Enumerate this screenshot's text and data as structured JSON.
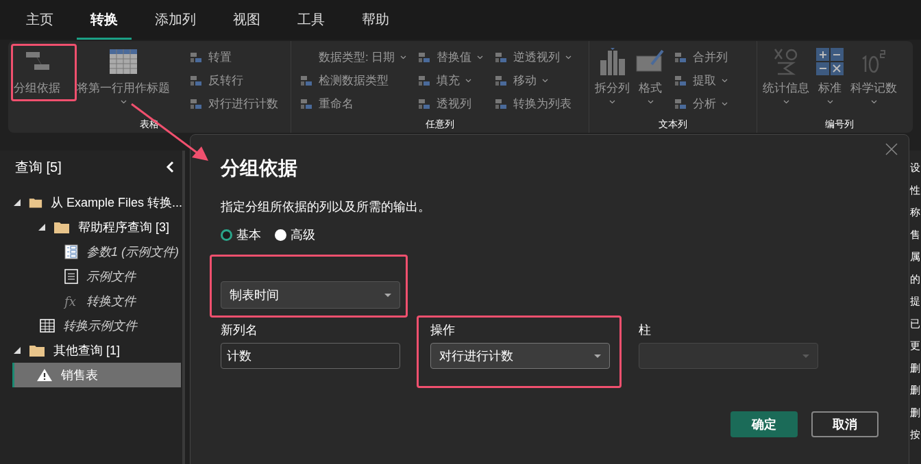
{
  "menu_tabs": [
    {
      "label": "主页",
      "selected": false
    },
    {
      "label": "转换",
      "selected": true
    },
    {
      "label": "添加列",
      "selected": false
    },
    {
      "label": "视图",
      "selected": false
    },
    {
      "label": "工具",
      "selected": false
    },
    {
      "label": "帮助",
      "selected": false
    }
  ],
  "ribbon": {
    "groups": [
      {
        "label": "表格",
        "items": [
          {
            "kind": "large",
            "label": "分组依据",
            "dropdown": false
          },
          {
            "kind": "large",
            "label": "将第一行用作标题",
            "dropdown": true
          },
          {
            "kind": "small",
            "label": "转置",
            "dropdown": false
          },
          {
            "kind": "small",
            "label": "反转行",
            "dropdown": false
          },
          {
            "kind": "small",
            "label": "对行进行计数",
            "dropdown": false
          }
        ]
      },
      {
        "label": "任意列",
        "items": [
          {
            "kind": "small",
            "label": "数据类型: 日期",
            "dropdown": true
          },
          {
            "kind": "small",
            "label": "检测数据类型",
            "dropdown": false
          },
          {
            "kind": "small",
            "label": "重命名",
            "dropdown": false
          },
          {
            "kind": "small",
            "label": "替换值",
            "dropdown": true
          },
          {
            "kind": "small",
            "label": "填充",
            "dropdown": true
          },
          {
            "kind": "small",
            "label": "透视列",
            "dropdown": false
          },
          {
            "kind": "small",
            "label": "逆透视列",
            "dropdown": true
          },
          {
            "kind": "small",
            "label": "移动",
            "dropdown": true
          },
          {
            "kind": "small",
            "label": "转换为列表",
            "dropdown": false
          }
        ]
      },
      {
        "label": "文本列",
        "items": [
          {
            "kind": "large",
            "label": "拆分列",
            "dropdown": true
          },
          {
            "kind": "large",
            "label": "格式",
            "dropdown": true
          },
          {
            "kind": "small",
            "label": "合并列",
            "dropdown": false
          },
          {
            "kind": "small",
            "label": "提取",
            "dropdown": true
          },
          {
            "kind": "small",
            "label": "分析",
            "dropdown": true
          }
        ]
      },
      {
        "label": "编号列",
        "items": [
          {
            "kind": "large",
            "label": "统计信息",
            "dropdown": true
          },
          {
            "kind": "large",
            "label": "标准",
            "dropdown": true
          },
          {
            "kind": "large",
            "label": "科学记数",
            "dropdown": true
          }
        ]
      }
    ]
  },
  "queries": {
    "title": "查询 [5]",
    "tree": [
      {
        "label": "从 Example Files 转换...",
        "kind": "folder",
        "italic": false,
        "selected": false,
        "expanded": true,
        "children": [
          {
            "label": "帮助程序查询 [3]",
            "kind": "folder",
            "italic": false,
            "selected": false,
            "expanded": true,
            "children": [
              {
                "label": "参数1 (示例文件)",
                "kind": "parameter",
                "italic": true,
                "selected": false
              },
              {
                "label": "示例文件",
                "kind": "document",
                "italic": true,
                "selected": false
              },
              {
                "label": "转换文件",
                "kind": "function",
                "glyph": "fx",
                "italic": true,
                "selected": false
              }
            ]
          },
          {
            "label": "转换示例文件",
            "kind": "table",
            "italic": true,
            "selected": false
          }
        ]
      },
      {
        "label": "其他查询 [1]",
        "kind": "folder",
        "italic": false,
        "selected": false,
        "expanded": true,
        "children": [
          {
            "label": "销售表",
            "kind": "warning",
            "italic": false,
            "selected": true
          }
        ]
      }
    ]
  },
  "settings_panel_fragments": [
    "设",
    "性",
    "称",
    "售",
    "属",
    "的",
    "提",
    "已",
    "更",
    "删",
    "删",
    "删",
    "按"
  ],
  "dialog": {
    "title": "分组依据",
    "description": "指定分组所依据的列以及所需的输出。",
    "modes": [
      {
        "label": "基本",
        "selected": true
      },
      {
        "label": "高级",
        "selected": false
      }
    ],
    "group_by": {
      "value": "制表时间"
    },
    "fields": [
      {
        "kind": "text",
        "label": "新列名",
        "value": "计数",
        "disabled": false
      },
      {
        "kind": "dropdown",
        "label": "操作",
        "value": "对行进行计数",
        "disabled": false
      },
      {
        "kind": "dropdown",
        "label": "柱",
        "disabled": true
      }
    ],
    "buttons": [
      {
        "label": "确定",
        "kind": "primary"
      },
      {
        "label": "取消",
        "kind": "secondary"
      }
    ]
  }
}
